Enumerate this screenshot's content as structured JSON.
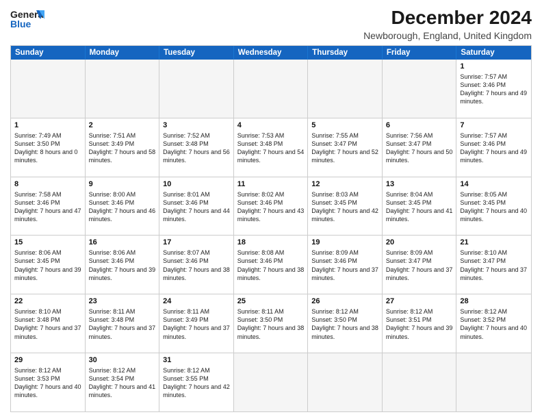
{
  "header": {
    "logo_general": "General",
    "logo_blue": "Blue",
    "title": "December 2024",
    "subtitle": "Newborough, England, United Kingdom"
  },
  "calendar": {
    "days": [
      "Sunday",
      "Monday",
      "Tuesday",
      "Wednesday",
      "Thursday",
      "Friday",
      "Saturday"
    ],
    "weeks": [
      [
        {
          "day": "",
          "empty": true
        },
        {
          "day": "",
          "empty": true
        },
        {
          "day": "",
          "empty": true
        },
        {
          "day": "",
          "empty": true
        },
        {
          "day": "",
          "empty": true
        },
        {
          "day": "",
          "empty": true
        },
        {
          "num": "1",
          "sunrise": "Sunrise: 7:57 AM",
          "sunset": "Sunset: 3:46 PM",
          "daylight": "Daylight: 7 hours and 49 minutes."
        }
      ],
      [
        {
          "num": "1",
          "sunrise": "Sunrise: 7:49 AM",
          "sunset": "Sunset: 3:50 PM",
          "daylight": "Daylight: 8 hours and 0 minutes."
        },
        {
          "num": "2",
          "sunrise": "Sunrise: 7:51 AM",
          "sunset": "Sunset: 3:49 PM",
          "daylight": "Daylight: 7 hours and 58 minutes."
        },
        {
          "num": "3",
          "sunrise": "Sunrise: 7:52 AM",
          "sunset": "Sunset: 3:48 PM",
          "daylight": "Daylight: 7 hours and 56 minutes."
        },
        {
          "num": "4",
          "sunrise": "Sunrise: 7:53 AM",
          "sunset": "Sunset: 3:48 PM",
          "daylight": "Daylight: 7 hours and 54 minutes."
        },
        {
          "num": "5",
          "sunrise": "Sunrise: 7:55 AM",
          "sunset": "Sunset: 3:47 PM",
          "daylight": "Daylight: 7 hours and 52 minutes."
        },
        {
          "num": "6",
          "sunrise": "Sunrise: 7:56 AM",
          "sunset": "Sunset: 3:47 PM",
          "daylight": "Daylight: 7 hours and 50 minutes."
        },
        {
          "num": "7",
          "sunrise": "Sunrise: 7:57 AM",
          "sunset": "Sunset: 3:46 PM",
          "daylight": "Daylight: 7 hours and 49 minutes."
        }
      ],
      [
        {
          "num": "8",
          "sunrise": "Sunrise: 7:58 AM",
          "sunset": "Sunset: 3:46 PM",
          "daylight": "Daylight: 7 hours and 47 minutes."
        },
        {
          "num": "9",
          "sunrise": "Sunrise: 8:00 AM",
          "sunset": "Sunset: 3:46 PM",
          "daylight": "Daylight: 7 hours and 46 minutes."
        },
        {
          "num": "10",
          "sunrise": "Sunrise: 8:01 AM",
          "sunset": "Sunset: 3:46 PM",
          "daylight": "Daylight: 7 hours and 44 minutes."
        },
        {
          "num": "11",
          "sunrise": "Sunrise: 8:02 AM",
          "sunset": "Sunset: 3:46 PM",
          "daylight": "Daylight: 7 hours and 43 minutes."
        },
        {
          "num": "12",
          "sunrise": "Sunrise: 8:03 AM",
          "sunset": "Sunset: 3:45 PM",
          "daylight": "Daylight: 7 hours and 42 minutes."
        },
        {
          "num": "13",
          "sunrise": "Sunrise: 8:04 AM",
          "sunset": "Sunset: 3:45 PM",
          "daylight": "Daylight: 7 hours and 41 minutes."
        },
        {
          "num": "14",
          "sunrise": "Sunrise: 8:05 AM",
          "sunset": "Sunset: 3:45 PM",
          "daylight": "Daylight: 7 hours and 40 minutes."
        }
      ],
      [
        {
          "num": "15",
          "sunrise": "Sunrise: 8:06 AM",
          "sunset": "Sunset: 3:45 PM",
          "daylight": "Daylight: 7 hours and 39 minutes."
        },
        {
          "num": "16",
          "sunrise": "Sunrise: 8:06 AM",
          "sunset": "Sunset: 3:46 PM",
          "daylight": "Daylight: 7 hours and 39 minutes."
        },
        {
          "num": "17",
          "sunrise": "Sunrise: 8:07 AM",
          "sunset": "Sunset: 3:46 PM",
          "daylight": "Daylight: 7 hours and 38 minutes."
        },
        {
          "num": "18",
          "sunrise": "Sunrise: 8:08 AM",
          "sunset": "Sunset: 3:46 PM",
          "daylight": "Daylight: 7 hours and 38 minutes."
        },
        {
          "num": "19",
          "sunrise": "Sunrise: 8:09 AM",
          "sunset": "Sunset: 3:46 PM",
          "daylight": "Daylight: 7 hours and 37 minutes."
        },
        {
          "num": "20",
          "sunrise": "Sunrise: 8:09 AM",
          "sunset": "Sunset: 3:47 PM",
          "daylight": "Daylight: 7 hours and 37 minutes."
        },
        {
          "num": "21",
          "sunrise": "Sunrise: 8:10 AM",
          "sunset": "Sunset: 3:47 PM",
          "daylight": "Daylight: 7 hours and 37 minutes."
        }
      ],
      [
        {
          "num": "22",
          "sunrise": "Sunrise: 8:10 AM",
          "sunset": "Sunset: 3:48 PM",
          "daylight": "Daylight: 7 hours and 37 minutes."
        },
        {
          "num": "23",
          "sunrise": "Sunrise: 8:11 AM",
          "sunset": "Sunset: 3:48 PM",
          "daylight": "Daylight: 7 hours and 37 minutes."
        },
        {
          "num": "24",
          "sunrise": "Sunrise: 8:11 AM",
          "sunset": "Sunset: 3:49 PM",
          "daylight": "Daylight: 7 hours and 37 minutes."
        },
        {
          "num": "25",
          "sunrise": "Sunrise: 8:11 AM",
          "sunset": "Sunset: 3:50 PM",
          "daylight": "Daylight: 7 hours and 38 minutes."
        },
        {
          "num": "26",
          "sunrise": "Sunrise: 8:12 AM",
          "sunset": "Sunset: 3:50 PM",
          "daylight": "Daylight: 7 hours and 38 minutes."
        },
        {
          "num": "27",
          "sunrise": "Sunrise: 8:12 AM",
          "sunset": "Sunset: 3:51 PM",
          "daylight": "Daylight: 7 hours and 39 minutes."
        },
        {
          "num": "28",
          "sunrise": "Sunrise: 8:12 AM",
          "sunset": "Sunset: 3:52 PM",
          "daylight": "Daylight: 7 hours and 40 minutes."
        }
      ],
      [
        {
          "num": "29",
          "sunrise": "Sunrise: 8:12 AM",
          "sunset": "Sunset: 3:53 PM",
          "daylight": "Daylight: 7 hours and 40 minutes."
        },
        {
          "num": "30",
          "sunrise": "Sunrise: 8:12 AM",
          "sunset": "Sunset: 3:54 PM",
          "daylight": "Daylight: 7 hours and 41 minutes."
        },
        {
          "num": "31",
          "sunrise": "Sunrise: 8:12 AM",
          "sunset": "Sunset: 3:55 PM",
          "daylight": "Daylight: 7 hours and 42 minutes."
        },
        {
          "day": "",
          "empty": true
        },
        {
          "day": "",
          "empty": true
        },
        {
          "day": "",
          "empty": true
        },
        {
          "day": "",
          "empty": true
        }
      ]
    ]
  }
}
